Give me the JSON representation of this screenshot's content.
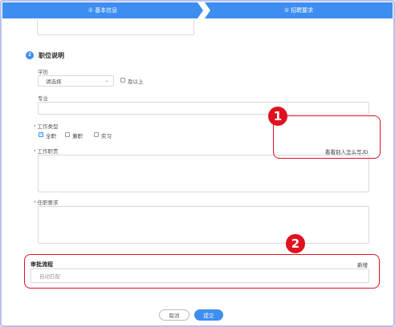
{
  "steps": [
    {
      "label": "① 基本信息"
    },
    {
      "label": "② 招聘要求"
    }
  ],
  "section": {
    "number": "2",
    "title": "职位说明"
  },
  "education": {
    "label": "学历",
    "select_value": "请选择",
    "above_label": "及以上"
  },
  "major": {
    "label": "专业"
  },
  "job_type": {
    "required_mark": "*",
    "label": "工作类型",
    "options": [
      {
        "label": "全职",
        "checked": true
      },
      {
        "label": "兼职",
        "checked": false
      },
      {
        "label": "实习",
        "checked": false
      }
    ]
  },
  "duties": {
    "required_mark": "*",
    "label": "工作职责",
    "jd_link": "看看别人怎么写JD"
  },
  "requirements": {
    "required_mark": "*",
    "label": "任职要求"
  },
  "approval": {
    "title": "审批流程",
    "add_label": "新增",
    "input_value": "自动匹配"
  },
  "markers": [
    {
      "label": "1"
    },
    {
      "label": "2"
    }
  ],
  "actions": {
    "cancel": "取消",
    "submit": "提交"
  },
  "colors": {
    "accent": "#3d8ef0",
    "highlight": "#e0121f",
    "required": "#e04545"
  },
  "icons": {
    "select_chevron": "chevron-down-icon",
    "checkmark": "check-icon"
  }
}
